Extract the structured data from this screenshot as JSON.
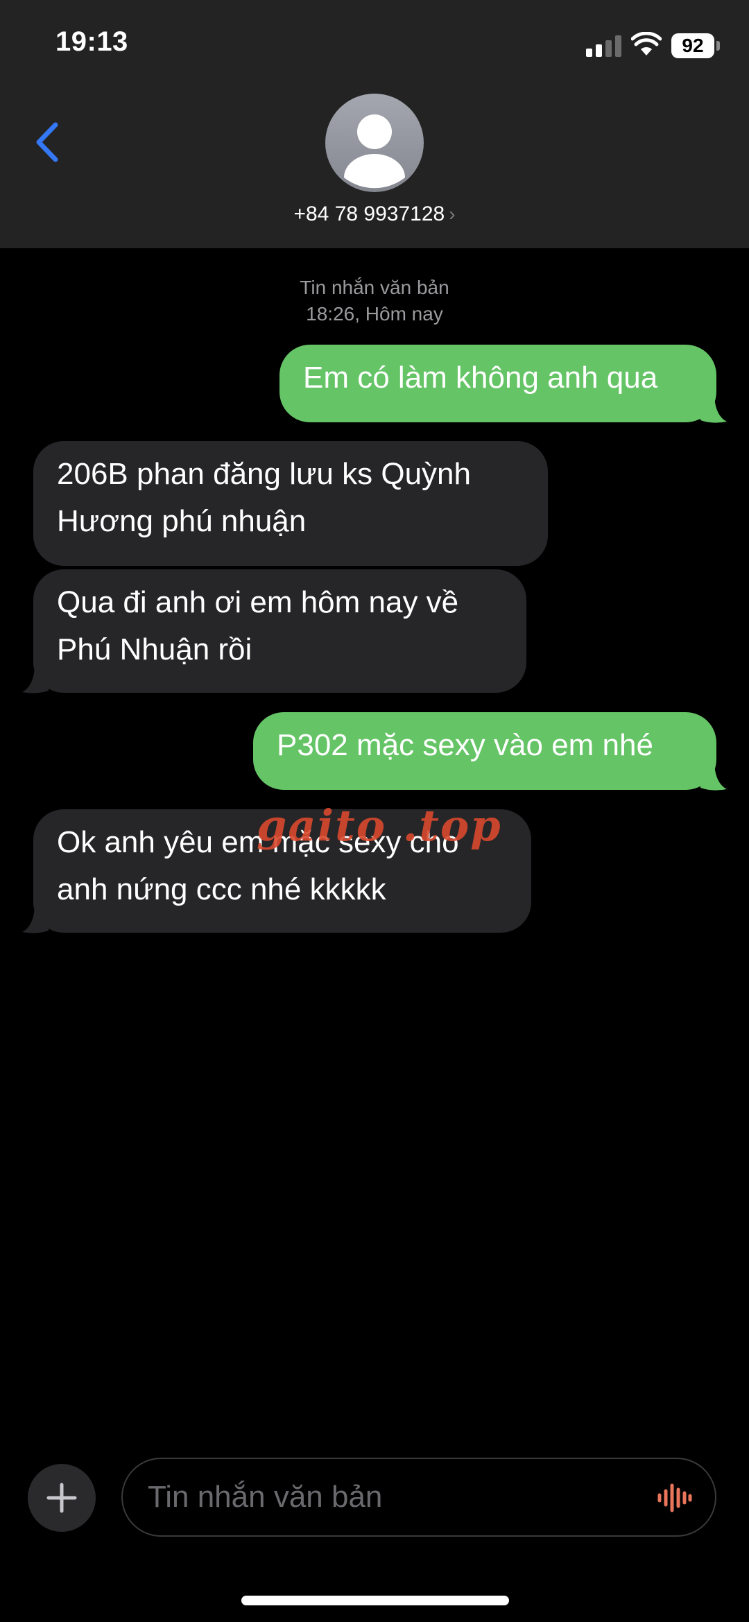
{
  "status_bar": {
    "time": "19:13",
    "battery": "92"
  },
  "header": {
    "contact": "+84 78 9937128",
    "chevron": "›",
    "back_icon": "chevron-left-icon"
  },
  "conversation": {
    "meta_line1": "Tin nhắn văn bản",
    "meta_line2": "18:26, Hôm nay",
    "messages": [
      {
        "direction": "outgoing",
        "lines": [
          "Em có làm không anh qua"
        ]
      },
      {
        "direction": "incoming",
        "lines": [
          "206B phan đăng lưu ks Quỳnh",
          "Hương phú nhuận"
        ]
      },
      {
        "direction": "incoming",
        "lines": [
          "Qua đi anh ơi em hôm nay về",
          "Phú Nhuận rồi"
        ]
      },
      {
        "direction": "outgoing",
        "lines": [
          "P302 mặc sexy vào em nhé"
        ]
      },
      {
        "direction": "incoming",
        "lines": [
          "Ok anh yêu em mặc sexy cho",
          "anh nứng ccc nhé kkkkk"
        ]
      }
    ]
  },
  "watermark": "gaito .top",
  "input": {
    "placeholder": "Tin nhắn văn bản",
    "plus_icon": "plus-icon",
    "mic_icon": "waveform-icon"
  },
  "colors": {
    "outgoing": "#65c466",
    "incoming": "#262628",
    "accent": "#3478f6",
    "watermark": "#d9492e"
  }
}
